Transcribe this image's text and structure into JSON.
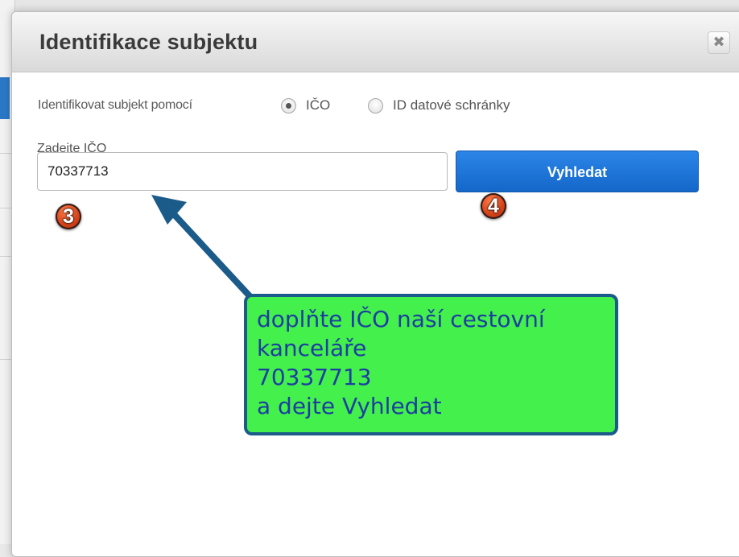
{
  "dialog": {
    "title": "Identifikace subjektu",
    "close_symbol": "✖",
    "identify_label": "Identifikovat subjekt pomocí",
    "radio_options": [
      {
        "label": "IČO",
        "selected": true
      },
      {
        "label": "ID datové schránky",
        "selected": false
      }
    ],
    "ico_field_label": "Zadejte IČO",
    "ico_value": "70337713",
    "search_button": "Vyhledat"
  },
  "annotations": {
    "step_input": "3",
    "step_button": "4",
    "callout_lines": [
      "doplňte IČO naší cestovní",
      "kanceláře",
      "70337713",
      "a dejte Vyhledat"
    ],
    "callout_color": "#44f04b",
    "arrow_color": "#1a5b8a"
  }
}
